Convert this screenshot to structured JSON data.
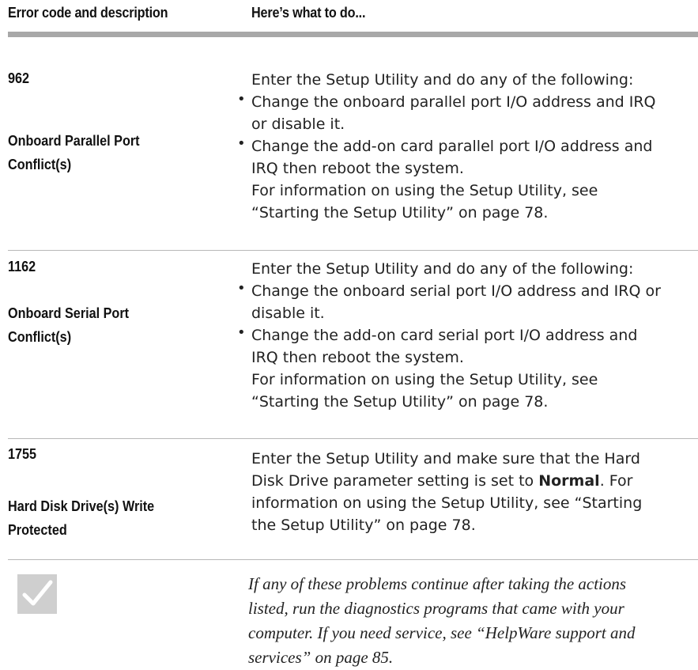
{
  "header": {
    "col1": "Error code and description",
    "col2": "Here’s what to do..."
  },
  "rows": [
    {
      "code": "962",
      "name_line1": "Onboard Parallel Port",
      "name_line2": "Conflict(s)",
      "intro": "Enter the Setup Utility and do any of the following:",
      "bullet1_line1": "Change the onboard parallel port I/O address and IRQ",
      "bullet1_line2": "or disable it.",
      "bullet2_line1": "Change the add-on card parallel port I/O address and",
      "bullet2_line2": "IRQ then reboot the system.",
      "info_line1": "For information on using the Setup Utility, see",
      "info_line2": "“Starting the Setup Utility” on page 78."
    },
    {
      "code": "1162",
      "name_line1": "Onboard Serial Port",
      "name_line2": "Conflict(s)",
      "intro": "Enter the Setup Utility and do any of the following:",
      "bullet1_line1": "Change the onboard serial port I/O address and IRQ or",
      "bullet1_line2": "disable it.",
      "bullet2_line1": "Change the add-on card serial port I/O address and",
      "bullet2_line2": "IRQ then reboot the system.",
      "info_line1": "For information on using the Setup Utility, see",
      "info_line2": "“Starting the Setup Utility” on page 78."
    },
    {
      "code": "1755",
      "name_line1": "Hard Disk Drive(s) Write",
      "name_line2": "Protected",
      "line1": "Enter the Setup Utility and make sure that the Hard",
      "line2_pre": "Disk Drive parameter setting is set to ",
      "line2_bold": "Normal",
      "line2_post": ". For",
      "line3": "information on using the Setup Utility, see “Starting",
      "line4": "the Setup Utility” on page 78."
    }
  ],
  "note": {
    "icon": "checkmark-icon",
    "line1": "If any of these problems continue after taking the actions",
    "line2": "listed, run the diagnostics programs that came with your",
    "line3": "computer. If you need service, see “HelpWare support and",
    "line4": "services” on page 85."
  },
  "colors": {
    "header_rule": "#a8a8a8",
    "row_rule": "#b8b8b8",
    "check_box": "#cfcfcf"
  }
}
